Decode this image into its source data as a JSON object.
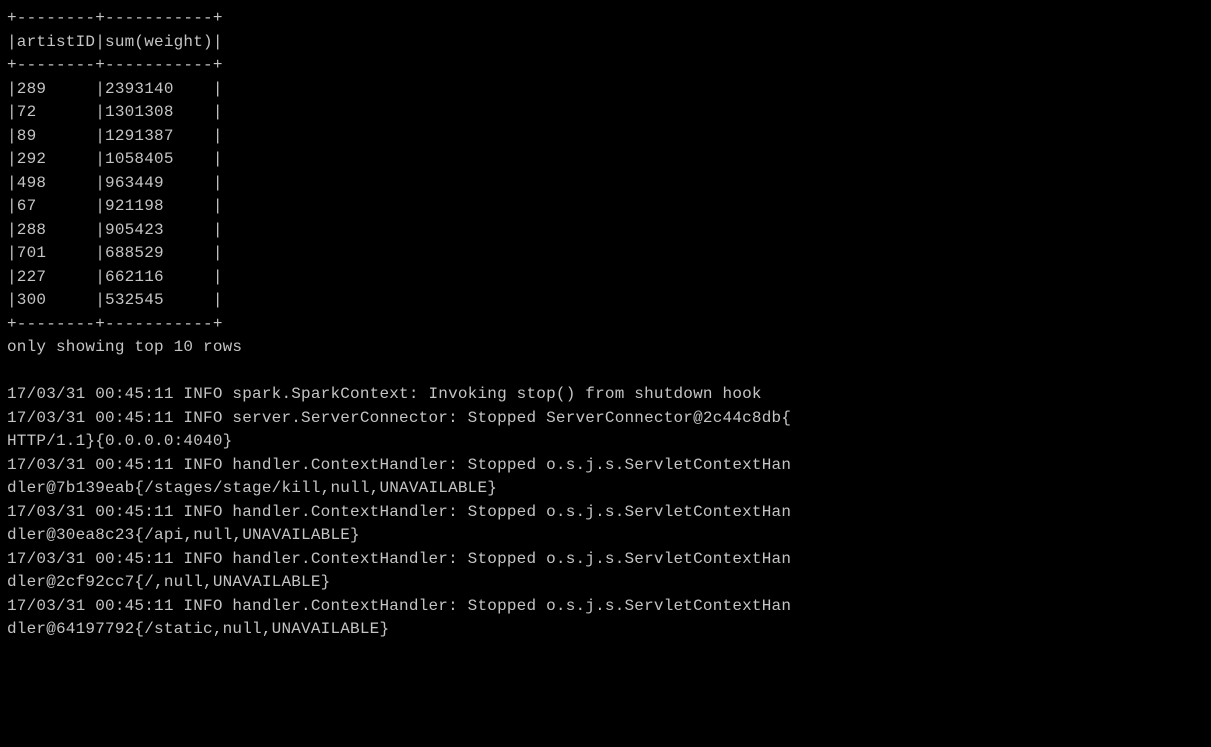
{
  "terminal": {
    "colors": {
      "background": "#000000",
      "foreground": "#c4c4c4"
    },
    "lines": [
      "+--------+-----------+",
      "|artistID|sum(weight)|",
      "+--------+-----------+",
      "|289     |2393140    |",
      "|72      |1301308    |",
      "|89      |1291387    |",
      "|292     |1058405    |",
      "|498     |963449     |",
      "|67      |921198     |",
      "|288     |905423     |",
      "|701     |688529     |",
      "|227     |662116     |",
      "|300     |532545     |",
      "+--------+-----------+",
      "only showing top 10 rows",
      "",
      "17/03/31 00:45:11 INFO spark.SparkContext: Invoking stop() from shutdown hook",
      "17/03/31 00:45:11 INFO server.ServerConnector: Stopped ServerConnector@2c44c8db{",
      "HTTP/1.1}{0.0.0.0:4040}",
      "17/03/31 00:45:11 INFO handler.ContextHandler: Stopped o.s.j.s.ServletContextHan",
      "dler@7b139eab{/stages/stage/kill,null,UNAVAILABLE}",
      "17/03/31 00:45:11 INFO handler.ContextHandler: Stopped o.s.j.s.ServletContextHan",
      "dler@30ea8c23{/api,null,UNAVAILABLE}",
      "17/03/31 00:45:11 INFO handler.ContextHandler: Stopped o.s.j.s.ServletContextHan",
      "dler@2cf92cc7{/,null,UNAVAILABLE}",
      "17/03/31 00:45:11 INFO handler.ContextHandler: Stopped o.s.j.s.ServletContextHan",
      "dler@64197792{/static,null,UNAVAILABLE}"
    ]
  }
}
